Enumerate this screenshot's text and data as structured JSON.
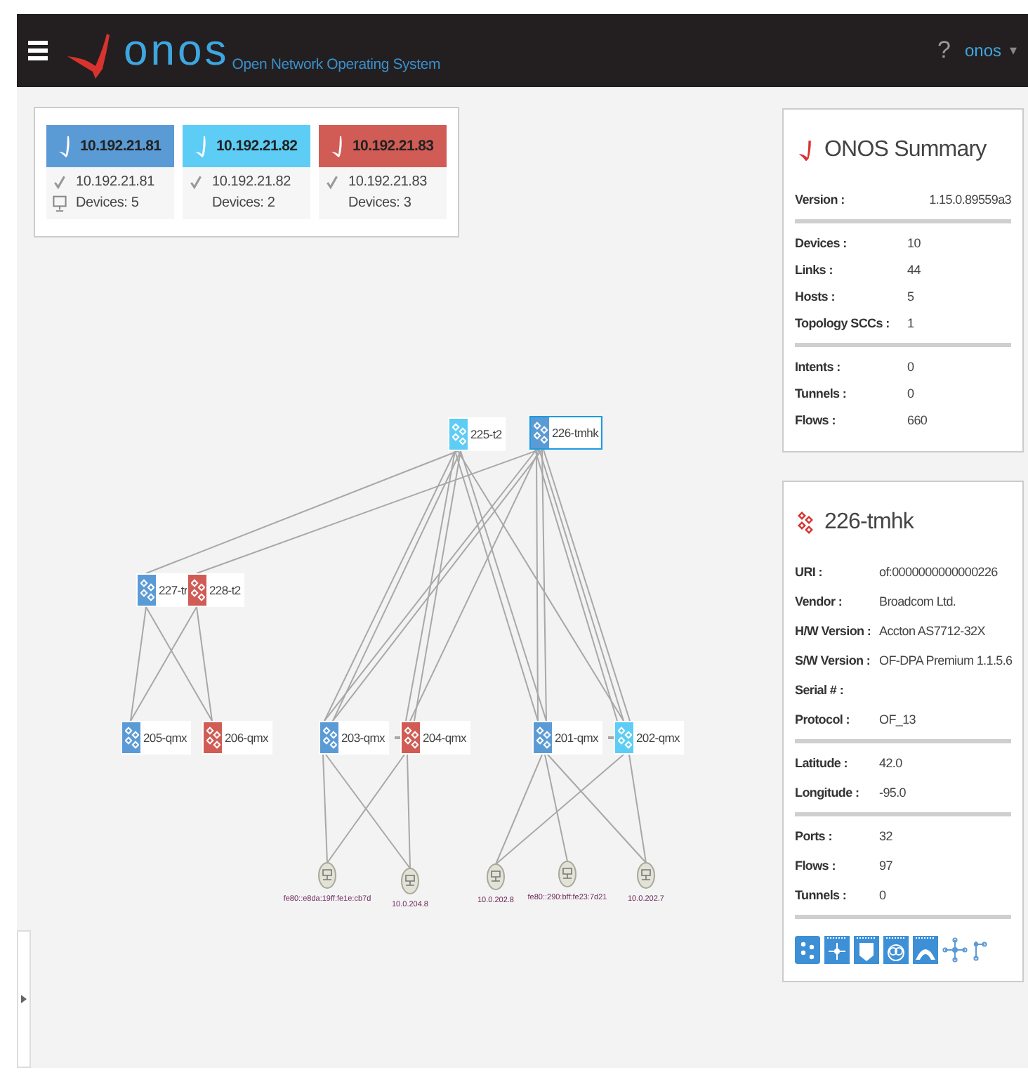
{
  "header": {
    "logo_text": "onos",
    "tagline": "Open Network Operating System",
    "help": "?",
    "user": "onos",
    "user_caret": "▾"
  },
  "cluster": [
    {
      "title": "10.192.21.81",
      "color": "#5b9bd5",
      "ip": "10.192.21.81",
      "online": true,
      "local": true,
      "devices": "Devices: 5"
    },
    {
      "title": "10.192.21.82",
      "color": "#5dcdf5",
      "ip": "10.192.21.82",
      "online": true,
      "local": false,
      "devices": "Devices: 2"
    },
    {
      "title": "10.192.21.83",
      "color": "#d05c55",
      "ip": "10.192.21.83",
      "online": true,
      "local": false,
      "devices": "Devices: 3"
    }
  ],
  "topology": {
    "nodes": [
      {
        "label": "225-t2",
        "color": "#5dcdf5",
        "selected": false
      },
      {
        "label": "226-tmhk",
        "color": "#5b9bd5",
        "selected": true
      },
      {
        "label": "227-tr",
        "color": "#5b9bd5",
        "selected": false
      },
      {
        "label": "228-t2",
        "color": "#d05c55",
        "selected": false
      },
      {
        "label": "205-qmx",
        "color": "#5b9bd5",
        "selected": false
      },
      {
        "label": "206-qmx",
        "color": "#d05c55",
        "selected": false
      },
      {
        "label": "203-qmx",
        "color": "#5b9bd5",
        "selected": false
      },
      {
        "label": "204-qmx",
        "color": "#d05c55",
        "selected": false
      },
      {
        "label": "201-qmx",
        "color": "#5b9bd5",
        "selected": false
      },
      {
        "label": "202-qmx",
        "color": "#5dcdf5",
        "selected": false
      }
    ],
    "hosts": [
      {
        "label": "fe80::e8da:19ff:fe1e:cb7d"
      },
      {
        "label": "10.0.204.8"
      },
      {
        "label": "10.0.202.8"
      },
      {
        "label": "fe80::290:bff:fe23:7d21"
      },
      {
        "label": "10.0.202.7"
      }
    ]
  },
  "summary": {
    "title": "ONOS Summary",
    "groups": [
      [
        {
          "label": "Version :",
          "value": "1.15.0.89559a3"
        }
      ],
      [
        {
          "label": "Devices :",
          "value": "10"
        },
        {
          "label": "Links :",
          "value": "44"
        },
        {
          "label": "Hosts :",
          "value": "5"
        },
        {
          "label": "Topology SCCs :",
          "value": "1"
        }
      ],
      [
        {
          "label": "Intents :",
          "value": "0"
        },
        {
          "label": "Tunnels :",
          "value": "0"
        },
        {
          "label": "Flows :",
          "value": "660"
        }
      ]
    ]
  },
  "device": {
    "title": "226-tmhk",
    "groups": [
      [
        {
          "label": "URI :",
          "value": "of:0000000000000226"
        },
        {
          "label": "Vendor :",
          "value": "Broadcom Ltd."
        },
        {
          "label": "H/W Version :",
          "value": "Accton AS7712-32X"
        },
        {
          "label": "S/W Version :",
          "value": "OF-DPA Premium 1.1.5.6"
        },
        {
          "label": "Serial # :"
        },
        {
          "label": "Protocol :",
          "value": "OF_13"
        }
      ],
      [
        {
          "label": "Latitude :",
          "value": "42.0"
        },
        {
          "label": "Longitude :",
          "value": "-95.0"
        }
      ],
      [
        {
          "label": "Ports :",
          "value": "32"
        },
        {
          "label": "Flows :",
          "value": "97"
        },
        {
          "label": "Tunnels :",
          "value": "0"
        }
      ]
    ]
  }
}
